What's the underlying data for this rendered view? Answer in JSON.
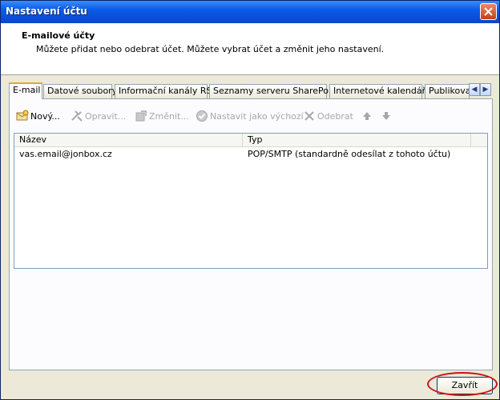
{
  "window": {
    "title": "Nastavení účtu"
  },
  "header": {
    "title": "E-mailové účty",
    "description": "Můžete přidat nebo odebrat účet. Můžete vybrat účet a změnit jeho nastavení."
  },
  "tabs": [
    {
      "label": "E-mail",
      "active": true
    },
    {
      "label": "Datové soubory",
      "active": false
    },
    {
      "label": "Informační kanály RSS",
      "active": false
    },
    {
      "label": "Seznamy serveru SharePoint",
      "active": false
    },
    {
      "label": "Internetové kalendáře",
      "active": false
    },
    {
      "label": "Publikovan",
      "active": false
    }
  ],
  "tab_scroll": {
    "left_icon": "chevron-left-icon",
    "right_icon": "chevron-right-icon"
  },
  "toolbar": {
    "new_label": "Nový...",
    "repair_label": "Opravit...",
    "change_label": "Změnit...",
    "set_default_label": "Nastavit jako výchozí",
    "remove_label": "Odebrat",
    "move_up_icon": "arrow-up-icon",
    "move_down_icon": "arrow-down-icon"
  },
  "list": {
    "columns": [
      "Název",
      "Typ"
    ],
    "rows": [
      {
        "name": "vas.email@jonbox.cz",
        "type": "POP/SMTP (standardně odesílat z tohoto účtu)"
      }
    ]
  },
  "footer": {
    "close_label": "Zavřít"
  },
  "colors": {
    "titlebar": "#0a5ce8",
    "annotation_oval": "#d01010",
    "active_tab_accent": "#e8a33d"
  }
}
